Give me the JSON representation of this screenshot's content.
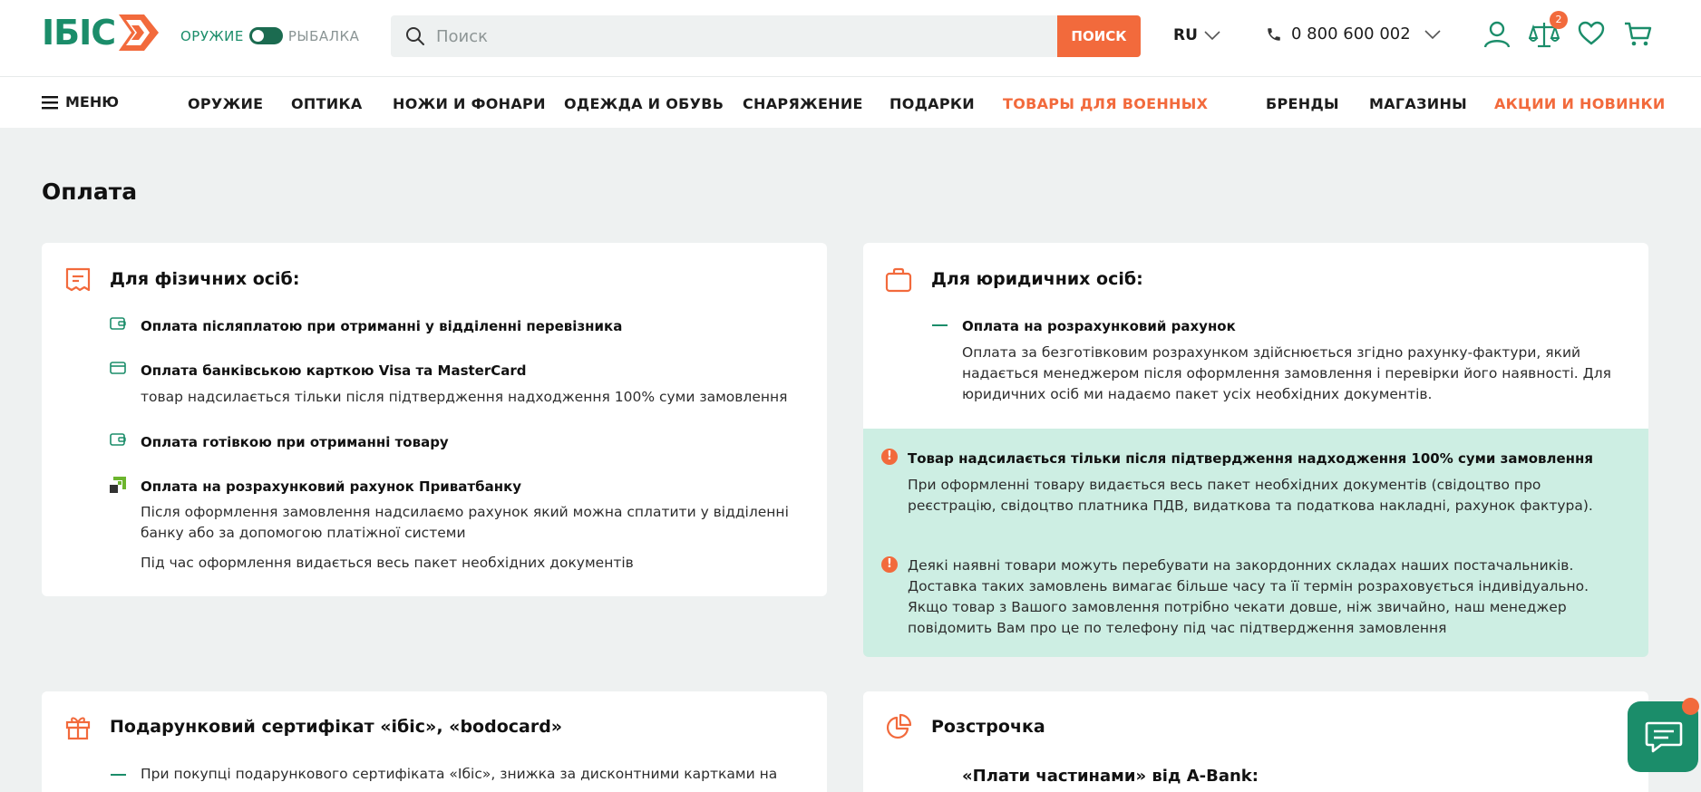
{
  "header": {
    "logo_text": "ІБІС",
    "switch": {
      "left": "ОРУЖИЕ",
      "right": "РЫБАЛКА"
    },
    "search": {
      "placeholder": "Поиск",
      "button": "ПОИСК"
    },
    "lang": "RU",
    "phone": "0 800 600 002",
    "compare_count": "2"
  },
  "nav": {
    "menu": "МЕНЮ",
    "items": [
      "ОРУЖИЕ",
      "ОПТИКА",
      "НОЖИ И ФОНАРИ",
      "ОДЕЖДА И ОБУВЬ",
      "СНАРЯЖЕНИЕ",
      "ПОДАРКИ",
      "ТОВАРЫ ДЛЯ ВОЕННЫХ",
      "БРЕНДЫ",
      "МАГАЗИНЫ",
      "АКЦИИ И НОВИНКИ"
    ]
  },
  "page": {
    "title": "Оплата"
  },
  "individuals": {
    "title": "Для фізичних осіб:",
    "items": [
      {
        "title": "Оплата післяплатою при отриманні у відділенні перевізника"
      },
      {
        "title": "Оплата банківською карткою Visa та MasterCard",
        "text": "товар надсилається тільки після підтвердження надходження 100% суми замовлення"
      },
      {
        "title": "Оплата готівкою при отриманні товару"
      },
      {
        "title": "Оплата на розрахунковий рахунок Приватбанку",
        "text": "Після оформлення замовлення надсилаємо рахунок який можна сплатити у відділенні банку або за допомогою платіжної системи",
        "text2": "Під час оформлення видається весь пакет необхідних документів"
      }
    ]
  },
  "legal": {
    "title": "Для юридичних осіб:",
    "item_title": "Оплата на розрахунковий рахунок",
    "item_text": "Оплата за безготівковим розрахунком здійснюється згідно рахунку-фактури, який надається менеджером після оформлення замовлення і перевірки його наявності. Для юридичних осіб ми надаємо пакет усіх необхідних документів.",
    "notice1_title": "Товар надсилається тільки після підтвердження надходження 100% суми замовлення",
    "notice1_text": "При оформленні товару видається весь пакет необхідних документів (свідоцтво про реєстрацію, свідоцтво платника ПДВ, видаткова та податкова накладні, рахунок фактура).",
    "notice2_text": "Деякі наявні товари можуть перебувати на закордонних складах наших постачальників. Доставка таких замовлень вимагає більше часу та її термін розраховується індивідуально. Якщо товар з Вашого замовлення потрібно чекати довше, ніж звичайно, наш менеджер повідомить Вам про це по телефону під час підтвердження замовлення"
  },
  "gift": {
    "title": "Подарунковий сертифікат «ібіс», «bodocard»",
    "text": "При покупці подарункового сертифіката «Ібіс», знижка за дисконтними картками на"
  },
  "installment": {
    "title": "Розстрочка",
    "subtitle": "«Плати частинами» від A-Bank:"
  },
  "colors": {
    "brand_green": "#1b8d6a",
    "accent_orange": "#f26a3c",
    "notice_bg": "#cdeee3",
    "page_bg": "#eef1f1"
  }
}
